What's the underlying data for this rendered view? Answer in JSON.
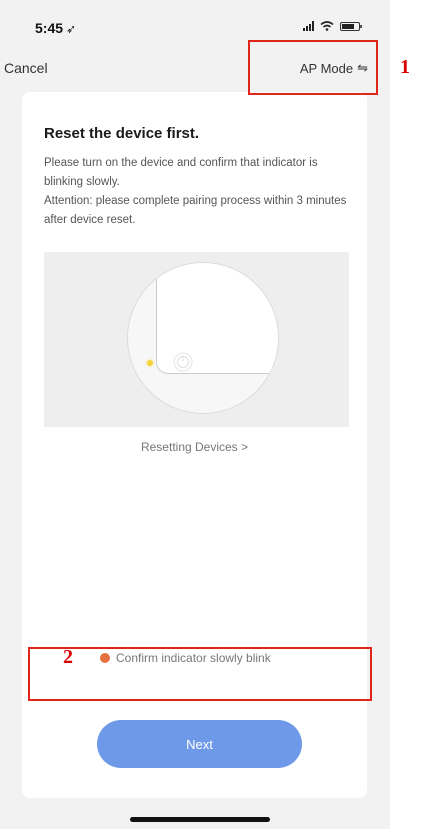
{
  "status_bar": {
    "time": "5:45",
    "location_glyph": "➶"
  },
  "nav": {
    "cancel_label": "Cancel",
    "mode_label": "AP Mode",
    "mode_icon": "⇋"
  },
  "card": {
    "title": "Reset the device first.",
    "description": "Please turn on the device and confirm that indicator is blinking slowly.",
    "attention": "Attention: please complete pairing process within 3 minutes after device reset.",
    "reset_link": "Resetting Devices >"
  },
  "confirm": {
    "label": "Confirm indicator slowly blink",
    "checked": true,
    "check_color": "#e6703d"
  },
  "next_label": "Next",
  "annotations": {
    "first": "1",
    "second": "2"
  },
  "colors": {
    "accent": "#6d99e8",
    "annotation": "#e0251b",
    "indicator_led": "#f2d53c"
  },
  "icons": {
    "signal": "signal-icon",
    "wifi": "wifi-icon",
    "battery": "battery-icon",
    "power": "power-icon",
    "led": "led-icon",
    "swap": "swap-icon"
  }
}
